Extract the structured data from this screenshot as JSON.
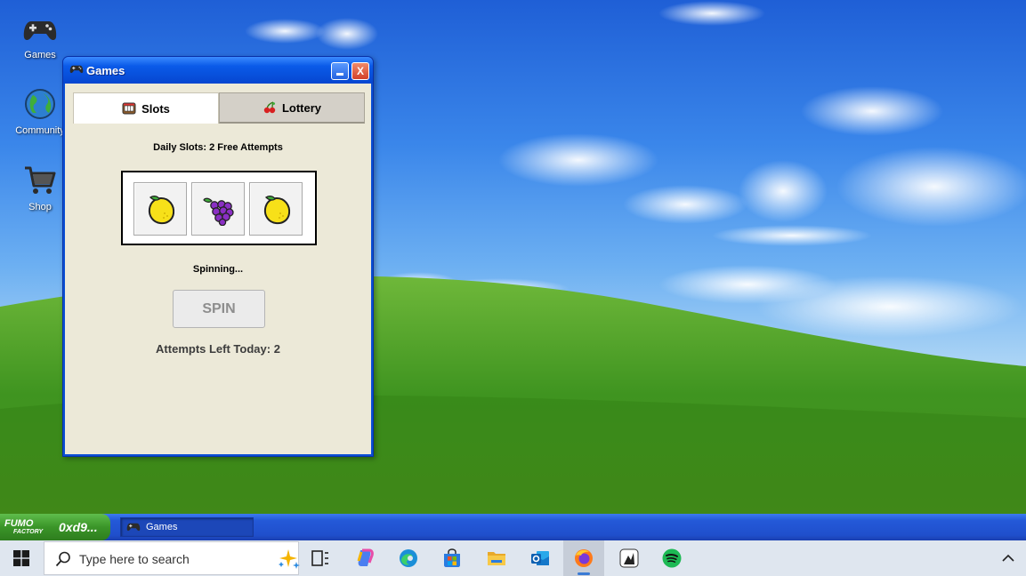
{
  "desktop": {
    "icons": [
      {
        "label": "Games",
        "icon": "gamepad-icon"
      },
      {
        "label": "Community",
        "icon": "globe-icon"
      },
      {
        "label": "Shop",
        "icon": "shopping-cart-icon"
      }
    ]
  },
  "window": {
    "title": "Games",
    "minimize_label": "",
    "close_label": "X",
    "tabs": [
      {
        "label": "Slots",
        "icon": "slot-machine-icon",
        "selected": true
      },
      {
        "label": "Lottery",
        "icon": "cherries-icon",
        "selected": false
      }
    ],
    "slots": {
      "heading": "Daily Slots: 2 Free Attempts",
      "reels": [
        "lemon-icon",
        "grapes-icon",
        "lemon-icon"
      ],
      "status": "Spinning...",
      "spin_label": "SPIN",
      "spin_enabled": false,
      "attempts_text": "Attempts Left Today: 2"
    }
  },
  "app_taskbar": {
    "start_logo": {
      "line1": "FUMO",
      "line2": "FACTORY"
    },
    "start_label": "0xd9...",
    "task": {
      "label": "Games",
      "icon": "gamepad-icon"
    }
  },
  "windows_taskbar": {
    "search_placeholder": "Type here to search",
    "apps": [
      "task-view-icon",
      "copilot-icon",
      "edge-icon",
      "store-icon",
      "file-explorer-icon",
      "outlook-icon",
      "firefox-icon",
      "app-icon",
      "spotify-icon"
    ],
    "active_app": "firefox-icon"
  },
  "colors": {
    "window_title": "#0a5ae8",
    "client_bg": "#ece9d8",
    "start_green": "#3a9528"
  }
}
